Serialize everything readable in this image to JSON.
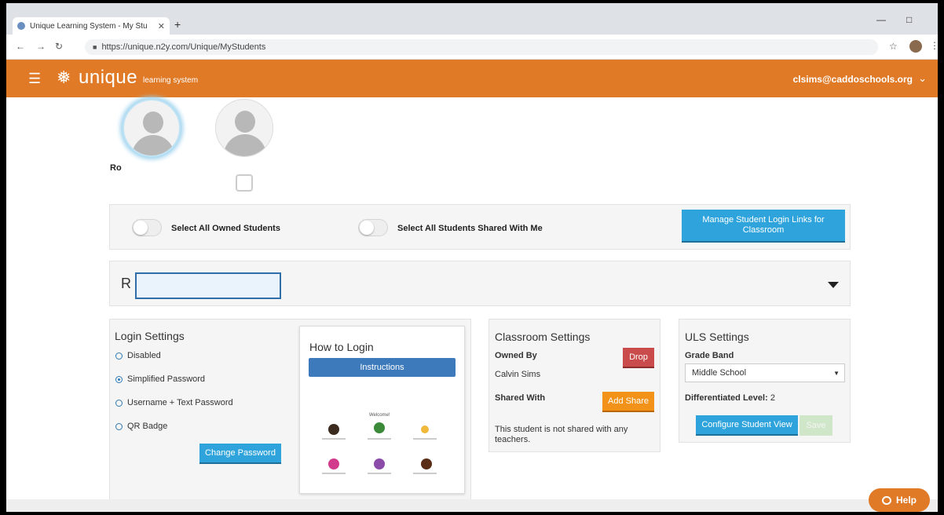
{
  "browser": {
    "tab_title": "Unique Learning System - My Stu",
    "tab_close": "✕",
    "new_tab": "+",
    "url": "https://unique.n2y.com/Unique/MyStudents"
  },
  "header": {
    "logo_text": "unique",
    "logo_subtitle": "learning system",
    "user_email": "clsims@caddoschools.org"
  },
  "students": {
    "selected_name_partial": "Ro"
  },
  "selection_bar": {
    "select_owned_label": "Select All Owned Students",
    "select_shared_label": "Select All Students Shared With Me",
    "manage_links_button": "Manage Student Login Links for Classroom"
  },
  "student_bar": {
    "initial": "R"
  },
  "login_settings": {
    "title": "Login Settings",
    "options": [
      "Disabled",
      "Simplified Password",
      "Username + Text Password",
      "QR Badge"
    ],
    "selected": "Simplified Password",
    "change_password_button": "Change Password"
  },
  "how_to_login": {
    "title": "How to Login",
    "instructions_button": "Instructions",
    "welcome_text": "Welcome!"
  },
  "classroom_settings": {
    "title": "Classroom Settings",
    "owned_by_label": "Owned By",
    "owner_name": "Calvin Sims",
    "drop_button": "Drop",
    "shared_with_label": "Shared With",
    "add_share_button": "Add Share",
    "not_shared_text": "This student is not shared with any teachers."
  },
  "uls_settings": {
    "title": "ULS Settings",
    "grade_band_label": "Grade Band",
    "grade_band_value": "Middle School",
    "differentiated_label": "Differentiated Level:",
    "differentiated_value": "2",
    "configure_button": "Configure Student View",
    "save_button": "Save"
  },
  "help": {
    "label": "Help"
  },
  "colors": {
    "brand_orange": "#e07a27",
    "button_blue": "#2fa4dc",
    "drop_red": "#c94b4b",
    "share_orange": "#f39219"
  }
}
